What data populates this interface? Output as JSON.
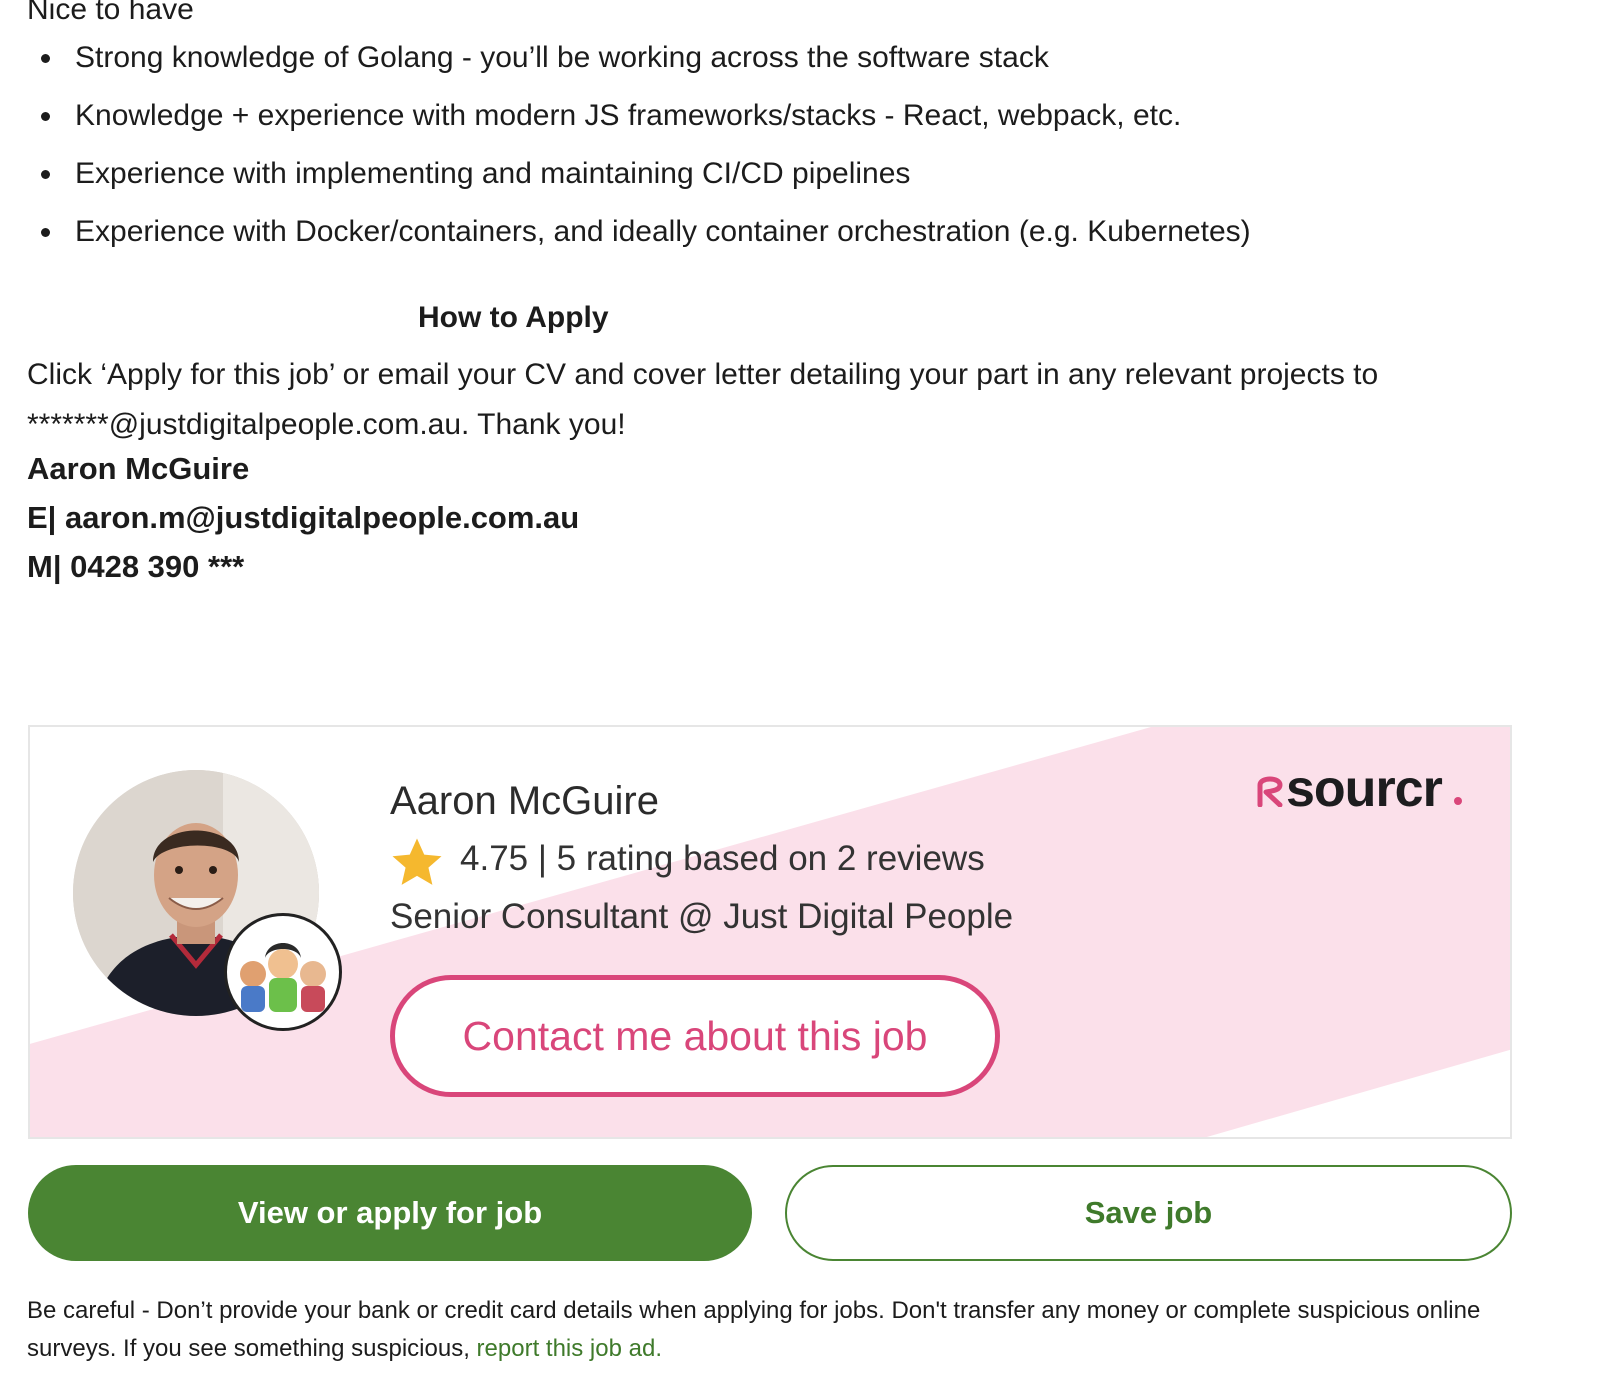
{
  "nice_to_have": {
    "heading": "Nice to have",
    "items": [
      "Strong knowledge of Golang - you’ll be working across the software stack",
      "Knowledge + experience with modern JS frameworks/stacks - React, webpack, etc.",
      "Experience with implementing and maintaining CI/CD pipelines",
      "Experience with Docker/containers, and ideally container orchestration (e.g. Kubernetes)"
    ]
  },
  "how_to_apply": {
    "heading": "How to Apply",
    "text": "Click ‘Apply for this job’ or email your CV and cover letter detailing your part in any relevant projects to *******@justdigitalpeople.com.au. Thank you!",
    "contact_name": "Aaron McGuire",
    "contact_email": "E| aaron.m@justdigitalpeople.com.au",
    "contact_phone": "M| 0428 390 ***"
  },
  "recruiter_card": {
    "name": "Aaron McGuire",
    "rating_text": "4.75 | 5 rating based on 2 reviews",
    "rating_value": 4.75,
    "role": "Senior Consultant @ Just Digital People",
    "contact_button": "Contact me about this job",
    "logo_text": "sourcr",
    "icons": [
      "avatar-photo",
      "agency-badge-icon",
      "star-icon",
      "sourcr-logo"
    ],
    "colors": {
      "accent_pink": "#d9467a",
      "band_pink": "#fbe0ea"
    }
  },
  "actions": {
    "apply_label": "View or apply for job",
    "save_label": "Save job",
    "color_primary": "#4a8533"
  },
  "warning": {
    "text": "Be careful - Don’t provide your bank or credit card details when applying for jobs. Don't transfer any money or complete suspicious online surveys. If you see something suspicious,",
    "link": "report this job ad."
  }
}
